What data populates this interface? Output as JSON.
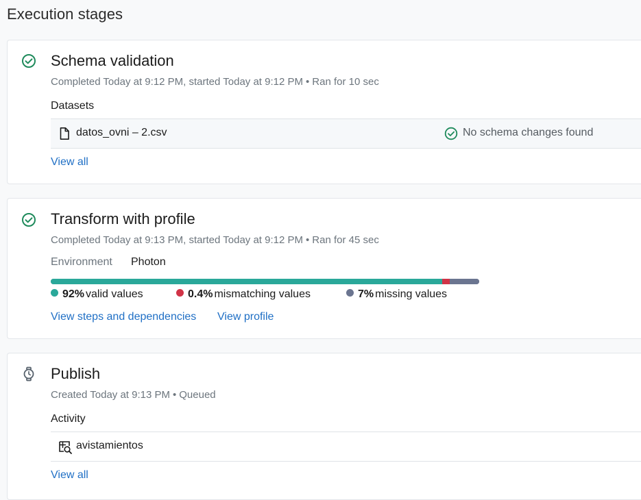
{
  "page": {
    "title": "Execution stages"
  },
  "stages": [
    {
      "title": "Schema validation",
      "meta": {
        "time": "Completed Today at 9:12 PM, started Today at 9:12 PM",
        "duration": "Ran for 10 sec"
      },
      "section_label": "Datasets",
      "dataset": {
        "name": "datos_ovni – 2.csv",
        "status": "No schema changes found"
      },
      "link": "View all",
      "icon": "check-circle-icon"
    },
    {
      "title": "Transform with profile",
      "meta": {
        "time": "Completed Today at 9:13 PM, started Today at 9:12 PM",
        "duration": "Ran for 45 sec"
      },
      "environment": {
        "label": "Environment",
        "value": "Photon"
      },
      "profile": {
        "valid": {
          "pct": "92%",
          "label": "valid values",
          "value": 92,
          "color": "#2aa89a"
        },
        "mismatch": {
          "pct": "0.4%",
          "label": "mismatching values",
          "value": 0.4,
          "color": "#d13447"
        },
        "missing": {
          "pct": "7%",
          "label": "missing values",
          "value": 7,
          "color": "#6b7590"
        }
      },
      "links": {
        "steps": "View steps and dependencies",
        "profile": "View profile"
      },
      "icon": "check-circle-icon"
    },
    {
      "title": "Publish",
      "meta": {
        "time": "Created Today at 9:13 PM",
        "duration": "Queued"
      },
      "section_label": "Activity",
      "output": {
        "name": "avistamientos"
      },
      "link": "View all",
      "icon": "stopwatch-icon"
    }
  ],
  "colors": {
    "success": "#1e8a5b",
    "link": "#1f6fc5",
    "muted": "#6c757d"
  }
}
